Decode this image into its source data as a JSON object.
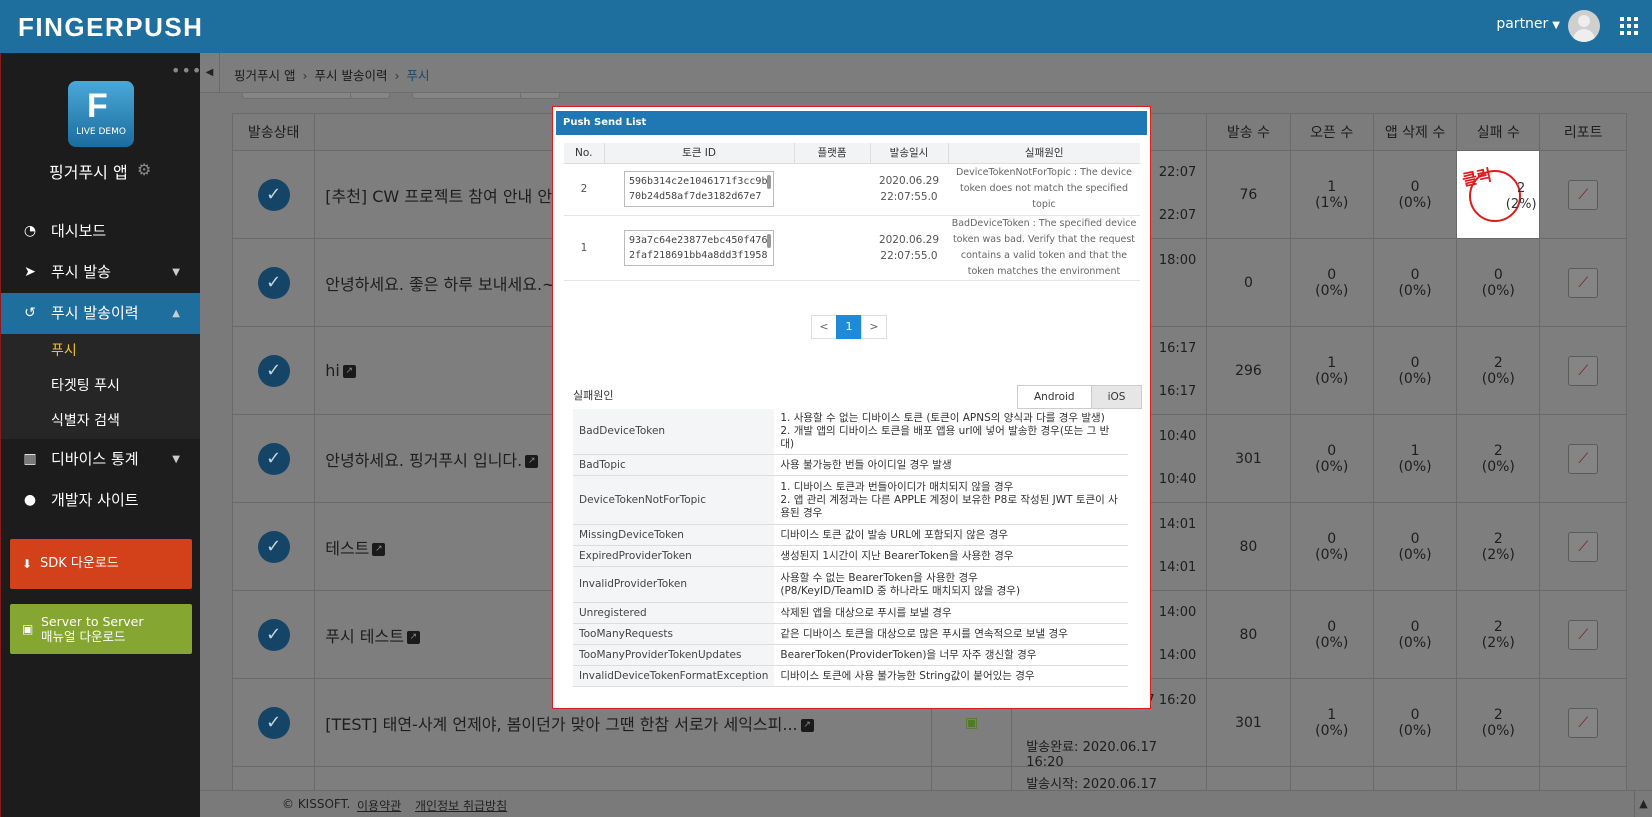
{
  "brand": "FINGERPUSH",
  "user": {
    "name": "partner"
  },
  "sidebar": {
    "logo_letter": "F",
    "logo_label": "LIVE DEMO",
    "app_name": "핑거푸시 앱",
    "menu": [
      {
        "label": "대시보드",
        "icon": "dashboard-icon"
      },
      {
        "label": "푸시 발송",
        "icon": "send-icon"
      },
      {
        "label": "푸시 발송이력",
        "icon": "history-icon"
      },
      {
        "label": "디바이스 통계",
        "icon": "bar-chart-icon"
      },
      {
        "label": "개발자 사이트",
        "icon": "user-icon"
      }
    ],
    "submenu": [
      "푸시",
      "타겟팅 푸시",
      "식별자 검색"
    ],
    "sdk_button": "SDK 다운로드",
    "s2s_button_line1": "Server to Server",
    "s2s_button_line2": "매뉴얼 다운로드"
  },
  "breadcrumb": [
    "핑거푸시 앱",
    "푸시 발송이력",
    "푸시"
  ],
  "table": {
    "headers": [
      "발송상태",
      "발송 수",
      "오픈 수",
      "앱 삭제 수",
      "실패 수",
      "리포트"
    ],
    "rows": [
      {
        "title": "[추천] CW 프로젝트 참여 안내 안",
        "t1": "22:07",
        "t2": "22:07",
        "sent": "76",
        "open": "1",
        "open_pct": "(1%)",
        "del": "0",
        "del_pct": "(0%)",
        "fail": "2",
        "fail_pct": "(2%)"
      },
      {
        "title": "안녕하세요. 좋은 하루 보내세요.~",
        "t1": "18:00",
        "t2": "",
        "sent": "0",
        "open": "0",
        "open_pct": "(0%)",
        "del": "0",
        "del_pct": "(0%)",
        "fail": "0",
        "fail_pct": "(0%)"
      },
      {
        "title": "hi",
        "t1": "16:17",
        "t2": "16:17",
        "sent": "296",
        "open": "1",
        "open_pct": "(0%)",
        "del": "0",
        "del_pct": "(0%)",
        "fail": "2",
        "fail_pct": "(0%)"
      },
      {
        "title": "안녕하세요. 핑거푸시 입니다.",
        "t1": "10:40",
        "t2": "10:40",
        "sent": "301",
        "open": "0",
        "open_pct": "(0%)",
        "del": "1",
        "del_pct": "(0%)",
        "fail": "2",
        "fail_pct": "(0%)"
      },
      {
        "title": "테스트",
        "t1": "14:01",
        "t2": "14:01",
        "sent": "80",
        "open": "0",
        "open_pct": "(0%)",
        "del": "0",
        "del_pct": "(0%)",
        "fail": "2",
        "fail_pct": "(2%)"
      },
      {
        "title": "푸시 테스트",
        "t1": "14:00",
        "t2": "14:00",
        "sent": "80",
        "open": "0",
        "open_pct": "(0%)",
        "del": "0",
        "del_pct": "(0%)",
        "fail": "2",
        "fail_pct": "(2%)"
      },
      {
        "title": "[TEST] 태연-사계 언제야, 봄이던가 맞아 그땐 한참 서로가 세익스피...",
        "t1": "17 16:20",
        "t2": "발송완료: 2020.06.17 16:20",
        "sent": "301",
        "open": "1",
        "open_pct": "(0%)",
        "del": "0",
        "del_pct": "(0%)",
        "fail": "2",
        "fail_pct": "(0%)"
      },
      {
        "title": "",
        "t1": "발송시작: 2020.06.17 16:20",
        "t2": "",
        "sent": "",
        "open": "",
        "open_pct": "",
        "del": "",
        "del_pct": "",
        "fail": "",
        "fail_pct": ""
      }
    ],
    "click_note": "클릭"
  },
  "footer": {
    "copyright": "© KISSOFT.",
    "terms": "이용약관",
    "privacy": "개인정보 취급방침"
  },
  "modal": {
    "title": "Push Send List",
    "columns": [
      "No.",
      "토큰 ID",
      "플랫폼",
      "발송일시",
      "실패원인"
    ],
    "rows": [
      {
        "no": "2",
        "token": "596b314c2e1046171f3cc9b70b24d58af7de3182d67e7",
        "date": "2020.06.29",
        "time": "22:07:55.0",
        "reason": "DeviceTokenNotForTopic : The device token does not match the specified topic"
      },
      {
        "no": "1",
        "token": "93a7c64e23877ebc450f4762faf218691bb4a8dd3f1958",
        "date": "2020.06.29",
        "time": "22:07:55.0",
        "reason": "BadDeviceToken : The specified device token was bad. Verify that the request contains a valid token and that the token matches the environment"
      }
    ],
    "pager": {
      "prev": "<",
      "current": "1",
      "next": ">"
    },
    "fail_title": "실패원인",
    "tabs": [
      "Android",
      "iOS"
    ],
    "fail_reasons": [
      {
        "key": "BadDeviceToken",
        "desc": "1. 사용할 수 없는 디바이스 토큰 (토큰이 APNS의 양식과 다를 경우 발생)\n2. 개발 앱의 디바이스 토큰을 배포 앱용 url에 넣어 발송한 경우(또는 그 반대)"
      },
      {
        "key": "BadTopic",
        "desc": "사용 불가능한 번들 아이디일 경우 발생"
      },
      {
        "key": "DeviceTokenNotForTopic",
        "desc": "1. 디바이스 토큰과 번들아이디가 매치되지 않을 경우\n2. 앱 관리 계정과는 다른 APPLE 계정이 보유한 P8로 작성된 JWT 토큰이 사용된 경우"
      },
      {
        "key": "MissingDeviceToken",
        "desc": "디바이스 토큰 값이 발송 URL에 포함되지 않은 경우"
      },
      {
        "key": "ExpiredProviderToken",
        "desc": "생성된지 1시간이 지난 BearerToken을 사용한 경우"
      },
      {
        "key": "InvalidProviderToken",
        "desc": "사용할 수 없는 BearerToken을 사용한 경우\n(P8/KeyID/TeamID 중 하나라도 매치되지 않을 경우)"
      },
      {
        "key": "Unregistered",
        "desc": "삭제된 앱을 대상으로 푸시를 보낼 경우"
      },
      {
        "key": "TooManyRequests",
        "desc": "같은 디바이스 토큰을 대상으로 많은 푸시를 연속적으로 보낼 경우"
      },
      {
        "key": "TooManyProviderTokenUpdates",
        "desc": "BearerToken(ProviderToken)을 너무 자주 갱신할 경우"
      },
      {
        "key": "InvalidDeviceTokenFormatException",
        "desc": "디바이스 토큰에 사용 불가능한 String값이 붙어있는 경우"
      }
    ]
  }
}
